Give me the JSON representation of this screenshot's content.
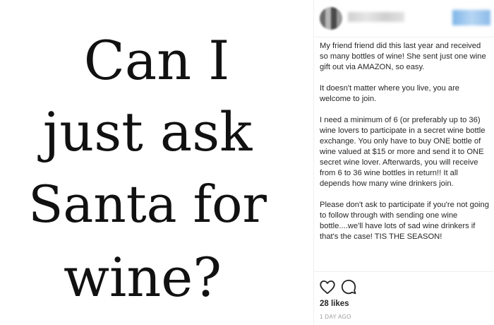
{
  "image": {
    "lines": [
      "Can I",
      "just ask",
      "Santa for",
      "wine?"
    ]
  },
  "post": {
    "caption": [
      "My friend friend did this last year and received so many bottles of wine! She sent just one wine gift out via AMAZON, so easy.",
      "It doesn't matter where you live, you are welcome to join.",
      "I need a minimum of 6 (or preferably up to 36) wine lovers to participate in a secret wine bottle exchange. You only have to buy ONE bottle of wine valued at $15 or more and send it to ONE secret wine lover. Afterwards, you will receive from 6 to 36 wine bottles in return!! It all depends how many wine drinkers join.",
      "Please don't ask to participate if you're not going to follow through with sending one wine bottle....we'll have lots of sad wine drinkers if that's the case! TIS THE SEASON!"
    ],
    "likes": "28 likes",
    "timestamp": "1 DAY AGO"
  },
  "icons": {
    "like": "heart-icon",
    "comment": "comment-icon"
  },
  "colors": {
    "follow_blue": "#3897f0",
    "text": "#262626",
    "muted": "#999999"
  }
}
